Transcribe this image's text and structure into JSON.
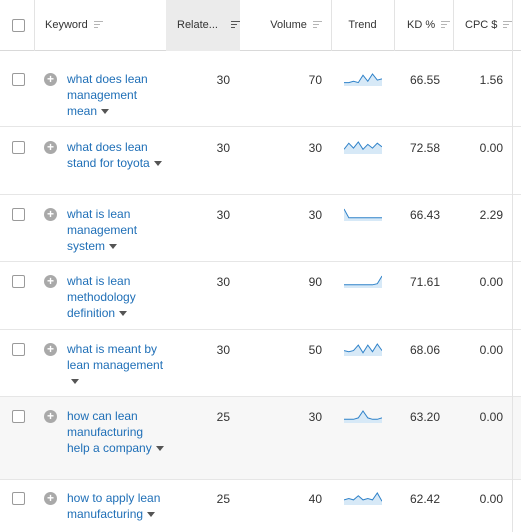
{
  "columns": {
    "keyword": "Keyword",
    "related": "Relate...",
    "volume": "Volume",
    "trend": "Trend",
    "kd": "KD %",
    "cpc": "CPC $"
  },
  "rows": [
    {
      "keyword": "what does lean management mean",
      "related": "30",
      "volume": "70",
      "kd": "66.55",
      "cpc": "1.56",
      "trend": [
        2,
        2,
        3,
        2,
        8,
        3,
        9,
        4,
        5
      ]
    },
    {
      "keyword": "what does lean stand for toyota",
      "related": "30",
      "volume": "30",
      "kd": "72.58",
      "cpc": "0.00",
      "trend": [
        3,
        8,
        4,
        9,
        3,
        7,
        4,
        8,
        5
      ]
    },
    {
      "keyword": "what is lean management system",
      "related": "30",
      "volume": "30",
      "kd": "66.43",
      "cpc": "2.29",
      "trend": [
        10,
        2,
        2,
        2,
        2,
        2,
        2,
        2,
        2
      ]
    },
    {
      "keyword": "what is lean methodology definition",
      "related": "30",
      "volume": "90",
      "kd": "71.61",
      "cpc": "0.00",
      "trend": [
        2,
        2,
        2,
        2,
        2,
        2,
        2,
        3,
        10
      ]
    },
    {
      "keyword": "what is meant by lean management",
      "related": "30",
      "volume": "50",
      "kd": "68.06",
      "cpc": "0.00",
      "trend": [
        4,
        3,
        4,
        9,
        2,
        9,
        3,
        10,
        4
      ]
    },
    {
      "keyword": "how can lean manufacturing help a company",
      "related": "25",
      "volume": "30",
      "kd": "63.20",
      "cpc": "0.00",
      "trend": [
        2,
        2,
        2,
        3,
        8,
        3,
        2,
        2,
        3
      ]
    },
    {
      "keyword": "how to apply lean manufacturing",
      "related": "25",
      "volume": "40",
      "kd": "62.42",
      "cpc": "0.00",
      "trend": [
        3,
        4,
        3,
        6,
        3,
        4,
        3,
        8,
        2
      ]
    }
  ]
}
